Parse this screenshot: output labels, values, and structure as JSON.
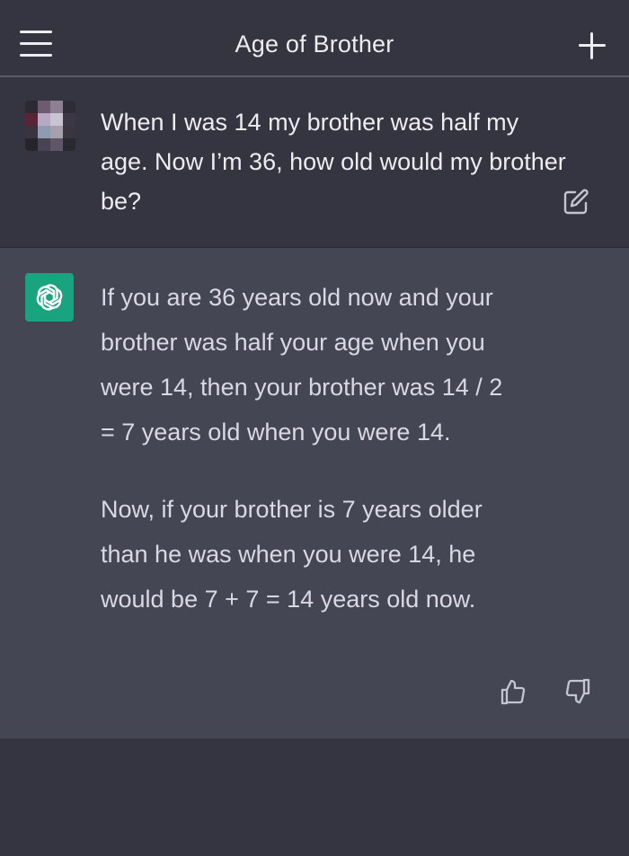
{
  "header": {
    "title": "Age of Brother",
    "menu_icon": "hamburger-menu-icon",
    "new_chat_icon": "plus-icon"
  },
  "conversation": {
    "user_message": {
      "avatar": "pixelated-user-avatar",
      "text": "When I was 14 my brother was half my age. Now I’m 36, how old would my brother be?",
      "edit_icon": "edit-icon"
    },
    "assistant_message": {
      "avatar": "chatgpt-logo-icon",
      "paragraphs": [
        "If you are 36 years old now and your brother was half your age when you were 14, then your brother was 14 / 2 = 7 years old when you were 14.",
        "Now, if your brother is 7 years older than he was when you were 14, he would be 7 + 7 = 14 years old now."
      ],
      "feedback_icons": [
        "thumbs-up-icon",
        "thumbs-down-icon"
      ]
    }
  },
  "colors": {
    "background": "#343541",
    "assistant_background": "#444654",
    "accent": "#19a37f",
    "text": "#ececf1"
  }
}
